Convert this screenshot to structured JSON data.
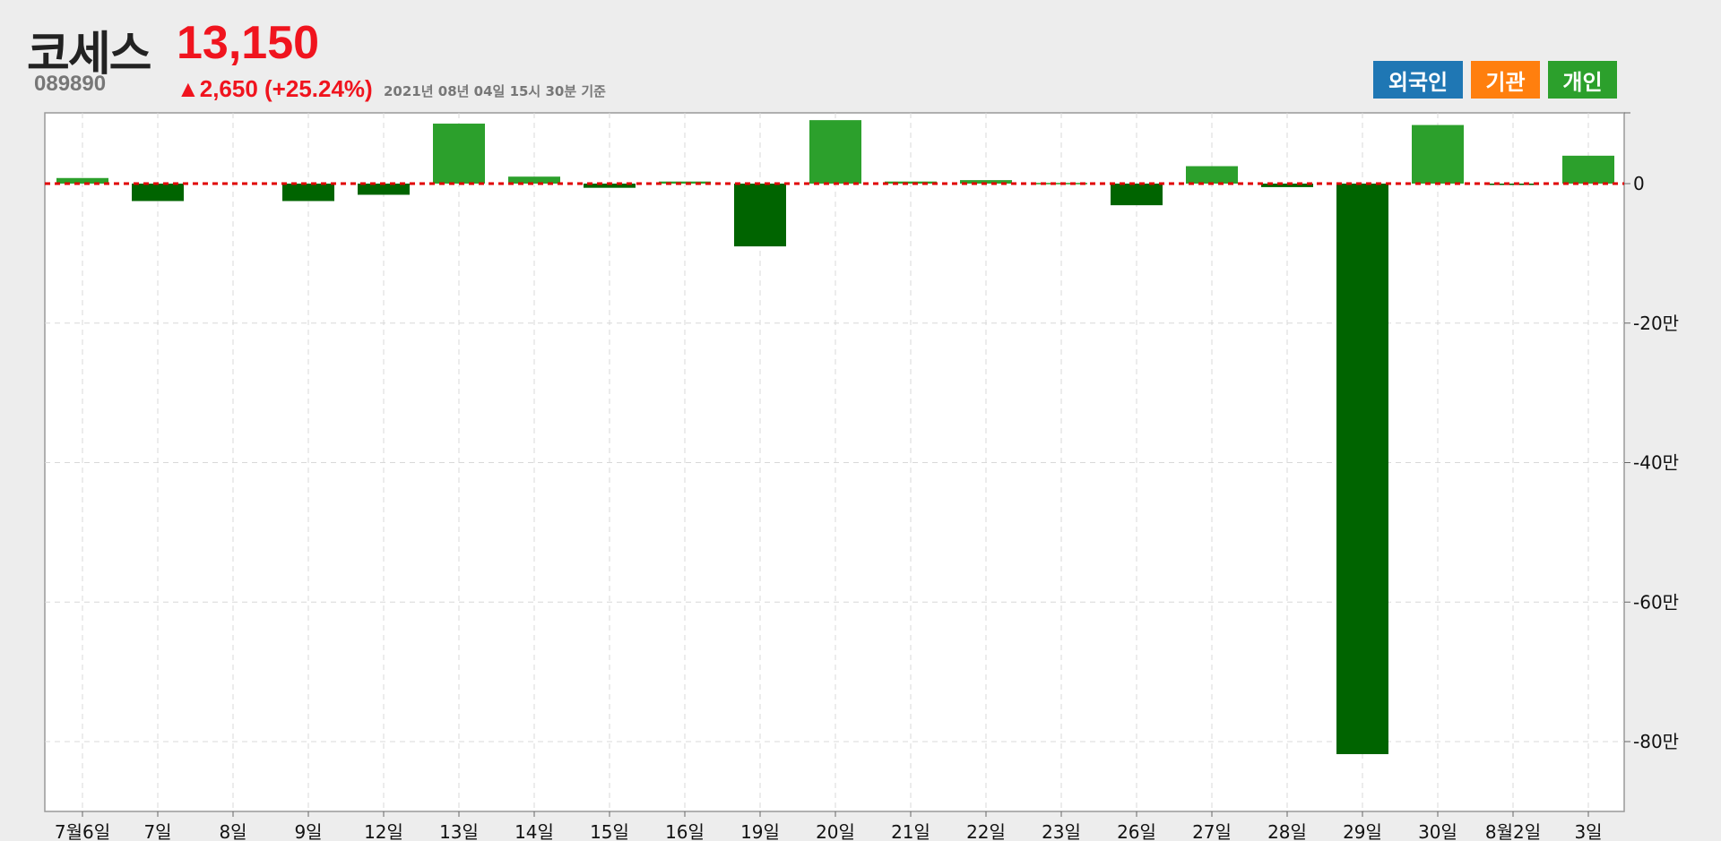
{
  "header": {
    "stock_name": "코세스",
    "stock_code": "089890",
    "price": "13,150",
    "change": "▲2,650 (+25.24%)",
    "as_of": "2021년 08년 04일 15시 30분 기준"
  },
  "legend": {
    "foreign": "외국인",
    "institution": "기관",
    "individual": "개인"
  },
  "colors": {
    "foreign": "#1f77b4",
    "institution": "#ff7f0e",
    "individual": "#2ca02c",
    "individual_negative": "#006400",
    "price_up": "#f0141e",
    "zero_line": "#e00000"
  },
  "chart_data": {
    "type": "bar",
    "series": [
      {
        "name": "개인",
        "values": [
          8000,
          -25000,
          0,
          -25000,
          -16000,
          86000,
          10000,
          -6000,
          3000,
          -90000,
          91000,
          3000,
          5000,
          1000,
          -31000,
          25000,
          -5000,
          -818000,
          84000,
          -2000,
          40000
        ]
      }
    ],
    "categories": [
      "7월6일",
      "7일",
      "8일",
      "9일",
      "12일",
      "13일",
      "14일",
      "15일",
      "16일",
      "19일",
      "20일",
      "21일",
      "22일",
      "23일",
      "26일",
      "27일",
      "28일",
      "29일",
      "30일",
      "8월2일",
      "3일"
    ],
    "ylim": [
      -900000,
      100000
    ],
    "yticks": [
      0,
      -200000,
      -400000,
      -600000,
      -800000
    ],
    "ytick_labels": [
      "0",
      "-20만",
      "-40만",
      "-60만",
      "-80만"
    ],
    "grid": true,
    "legend_position": "top-right"
  }
}
